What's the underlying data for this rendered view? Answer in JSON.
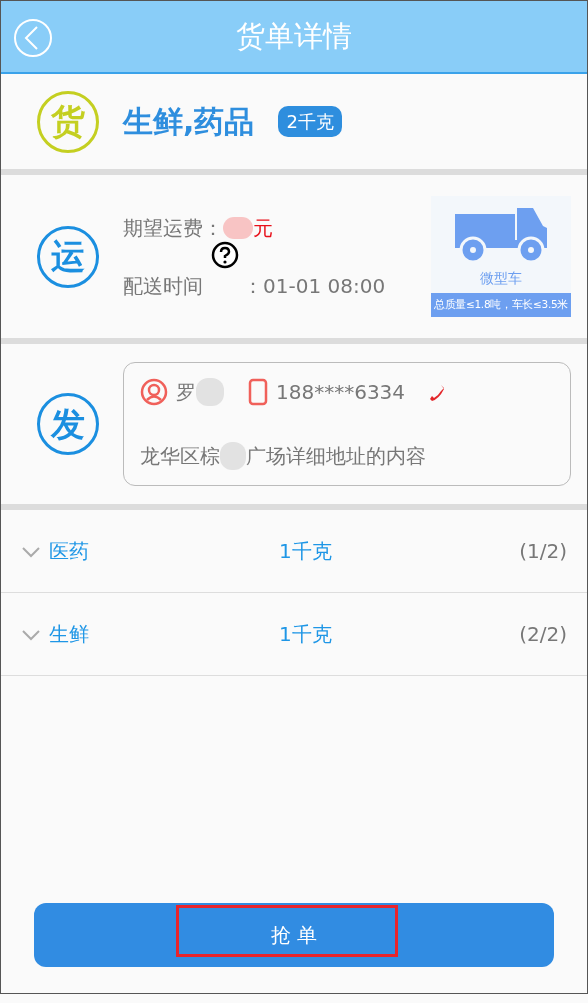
{
  "header": {
    "title": "货单详情"
  },
  "cargo": {
    "badge_char": "货",
    "name": "生鲜,药品",
    "weight": "2千克"
  },
  "shipping": {
    "badge_char": "运",
    "fee_label": "期望运费：",
    "fee_unit": "元",
    "time_label": "配送时间",
    "time_value": "：01-01 08:00",
    "vehicle": {
      "name": "微型车",
      "spec": "总质量≤1.8吨，车长≤3.5米"
    }
  },
  "sender": {
    "badge_char": "发",
    "name": "罗",
    "phone": "188****6334",
    "address_start": "龙华区棕",
    "address_end": "广场详细地址的内容"
  },
  "items": [
    {
      "name": "医药",
      "weight": "1千克",
      "index": "(1/2)"
    },
    {
      "name": "生鲜",
      "weight": "1千克",
      "index": "(2/2)"
    }
  ],
  "action": {
    "label": "抢 单"
  }
}
